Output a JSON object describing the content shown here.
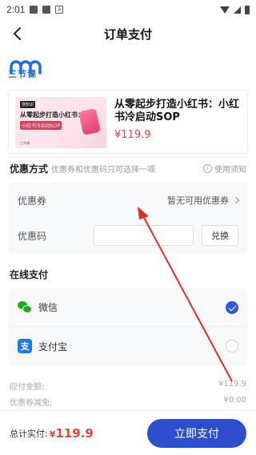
{
  "status_bar": {
    "time": "2:01"
  },
  "nav": {
    "title": "订单支付"
  },
  "brand": {
    "name": "三节课",
    "color": "#1e6fd9"
  },
  "course": {
    "thumb_tag": "涨知识",
    "thumb_line1": "从零起步打造小红书：",
    "thumb_line2": "小红书冷启动SOP",
    "thumb_footer": "三节课",
    "title": "从零起步打造小红书：小红书冷启动SOP",
    "price": "¥119.9"
  },
  "discount": {
    "heading": "优惠方式",
    "subtitle": "优惠券和优惠码只可选择一项",
    "help_label": "使用须知",
    "coupon_label": "优惠券",
    "coupon_value": "暂无可用优惠券",
    "code_label": "优惠码",
    "code_value": "",
    "code_placeholder": "",
    "redeem_label": "兑换"
  },
  "payment": {
    "heading": "在线支付",
    "options": [
      {
        "name": "微信",
        "selected": true
      },
      {
        "name": "支付宝",
        "selected": false
      }
    ]
  },
  "summary": {
    "payable_label": "应付金额:",
    "payable_value": "¥119.9",
    "coupon_reduce_label": "优惠券减免:",
    "coupon_reduce_value": "¥0.00"
  },
  "footer": {
    "total_label": "总计实付:",
    "total_currency": "¥",
    "total_amount": "119.9",
    "pay_button": "立即支付"
  },
  "colors": {
    "accent": "#2c4fcf",
    "price_red": "#e8463a",
    "annotation_red": "#d9302c"
  }
}
